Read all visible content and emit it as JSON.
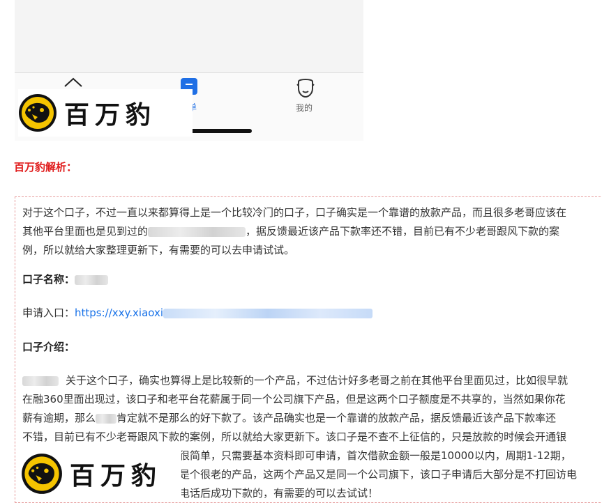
{
  "phone": {
    "tab_mid_label": "单",
    "tab_mine_label": "我的"
  },
  "brand": {
    "name": "百万豹",
    "accent_color": "#f5c400",
    "title_color": "#e01b1b"
  },
  "section": {
    "title": "百万豹解析："
  },
  "article": {
    "p1_line1": "对于这个口子，不过一直以来都算得上是一个比较冷门的口子，口子确实是一个靠谱的放款产品，而且很多老哥应该在",
    "p1_line2_a": "其他平台里面也是见到过的",
    "p1_line2_b": "，据反馈最近该产品下款率还不错，目前已有不少老哥跟风下款的案",
    "p1_line3": "例，所以就给大家整理更新下，有需要的可以去申请试试。",
    "name_label": "口子名称：",
    "entry_label": "申请入口：",
    "entry_link_visible": "https://xxy.xiaoxi",
    "intro_label": "口子介绍：",
    "p2_line1": "关于这个口子，确实也算得上是比较新的一个产品，不过估计好多老哥之前在其他平台里面见过，比如很早就",
    "p2_line2": "在融360里面出现过，该口子和老平台花薪属于同一个公司旗下产品，但是这两个口子额度是不共享的，当然如果你花",
    "p2_line3_a": "薪有逾期，那么",
    "p2_line3_b": "肯定就不是那么的好下款了。该产品确实也是一个靠谱的放款产品，据反馈最近该产品下款率还",
    "p2_line4": "不错，目前已有不少老哥跟风下款的案例，所以就给大家更新下。该口子是不查不上征信的，只是放款的时候会开通银",
    "p2_line5": "行存管账户放款的而已，申请资料很简单，只需要基本资料即可申请，首次借款金额一般是10000以内，周期1-12期，",
    "p2_line6": "是个很老的产品，这两个产品又是同一个公司旗下，该口子申请后大部分是不打回访电",
    "p2_line7": "电话后成功下款的，有需要的可以去试试！"
  }
}
